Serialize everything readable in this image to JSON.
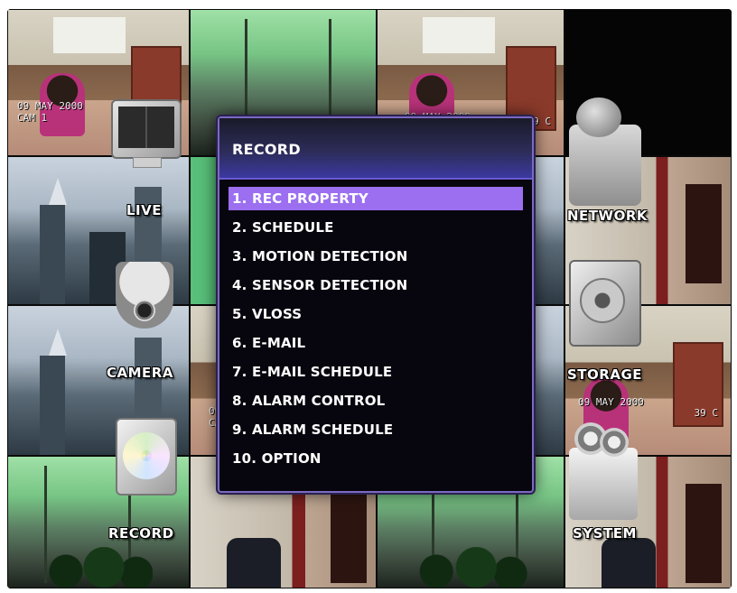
{
  "side_menu": {
    "live": "LIVE",
    "camera": "CAMERA",
    "record": "RECORD",
    "network": "NETWORK",
    "storage": "STORAGE",
    "system": "SYSTEM"
  },
  "camera_osd": {
    "date_a": "09 MAY 2000",
    "cam_a": "CAM 1",
    "date_b": "09 MAY 2000",
    "temp_b": "39 C",
    "date_c": "09 MAY 2000",
    "temp_c": "39 C",
    "date_d": "09",
    "cam_d": "CAM"
  },
  "menu": {
    "title": "RECORD",
    "selected_index": 0,
    "items": [
      "1. REC PROPERTY",
      "2. SCHEDULE",
      "3. MOTION DETECTION",
      "4. SENSOR DETECTION",
      "5. VLOSS",
      "6. E-MAIL",
      "7. E-MAIL SCHEDULE",
      "8. ALARM CONTROL",
      "9. ALARM SCHEDULE",
      "10. OPTION"
    ]
  },
  "colors": {
    "selection": "#9b6ff0",
    "menu_border": "#7b6ac0",
    "header_gradient_end": "#3b39a0"
  },
  "icons": {
    "live": "monitor-quad-icon",
    "camera": "ptz-camera-icon",
    "record": "disc-drive-icon",
    "network": "network-device-icon",
    "storage": "hard-disk-icon",
    "system": "gears-device-icon"
  }
}
